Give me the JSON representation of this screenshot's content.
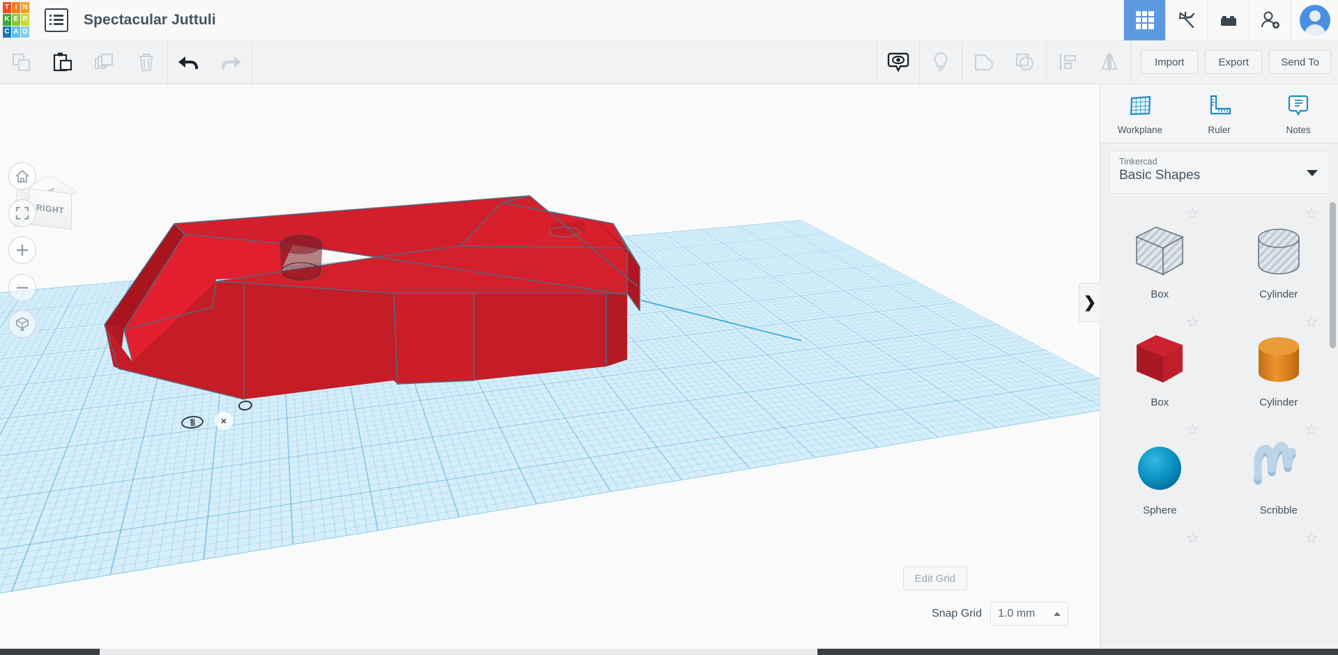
{
  "app": {
    "name": "Tinkercad",
    "logo_letters": [
      "T",
      "I",
      "N",
      "K",
      "E",
      "R",
      "C",
      "A",
      "D"
    ],
    "logo_colors": [
      "#f04c24",
      "#f57c20",
      "#f99d1c",
      "#39a935",
      "#8cc63e",
      "#cbdb2a",
      "#1b75bb",
      "#5bc2e7",
      "#7fcdee"
    ]
  },
  "header": {
    "document_title": "Spectacular Juttuli",
    "menu_icon": "list-menu-icon",
    "right_buttons": [
      {
        "name": "designs-grid",
        "icon": "grid-9-icon",
        "active": true
      },
      {
        "name": "codeblocks",
        "icon": "pickaxe-icon",
        "active": false
      },
      {
        "name": "blocks",
        "icon": "lego-brick-icon",
        "active": false
      },
      {
        "name": "invite-people",
        "icon": "add-person-icon",
        "active": false
      }
    ],
    "avatar": "user-avatar"
  },
  "toolbar": {
    "left_tools": [
      {
        "name": "copy",
        "icon": "copy-icon",
        "enabled": false
      },
      {
        "name": "paste",
        "icon": "paste-icon",
        "enabled": true
      },
      {
        "name": "duplicate",
        "icon": "duplicate-icon",
        "enabled": false
      },
      {
        "name": "delete",
        "icon": "trash-icon",
        "enabled": false
      }
    ],
    "history_tools": [
      {
        "name": "undo",
        "icon": "undo-arrow-icon",
        "enabled": true
      },
      {
        "name": "redo",
        "icon": "redo-arrow-icon",
        "enabled": false
      }
    ],
    "center_tools": [
      {
        "name": "show-hide",
        "icon": "eye-bubble-icon",
        "enabled": true
      },
      {
        "name": "light",
        "icon": "lightbulb-icon",
        "enabled": false
      },
      {
        "name": "group",
        "icon": "group-shapes-icon",
        "enabled": false
      },
      {
        "name": "ungroup",
        "icon": "ungroup-shapes-icon",
        "enabled": false
      },
      {
        "name": "align",
        "icon": "align-icon",
        "enabled": false
      },
      {
        "name": "mirror",
        "icon": "mirror-icon",
        "enabled": false
      }
    ],
    "import_label": "Import",
    "export_label": "Export",
    "send_to_label": "Send To"
  },
  "viewport": {
    "view_cube": {
      "front_face": "RIGHT",
      "top_face": "TOP"
    },
    "nav_buttons": [
      {
        "name": "home-view",
        "icon": "home-icon"
      },
      {
        "name": "fit-to-view",
        "icon": "fit-frame-icon"
      },
      {
        "name": "zoom-in",
        "icon": "plus-icon"
      },
      {
        "name": "zoom-out",
        "icon": "minus-icon"
      },
      {
        "name": "view-toggle",
        "icon": "ortho-cube-icon"
      }
    ],
    "edit_grid_label": "Edit Grid",
    "snap_grid_label": "Snap Grid",
    "snap_grid_value": "1.0 mm",
    "model_color": "#cf1c28",
    "workplane_color": "#d6eef9"
  },
  "right_panel": {
    "tools": [
      {
        "label": "Workplane",
        "icon": "workplane-grid-icon"
      },
      {
        "label": "Ruler",
        "icon": "ruler-icon"
      },
      {
        "label": "Notes",
        "icon": "notes-bubble-icon"
      }
    ],
    "library_source": "Tinkercad",
    "library_name": "Basic Shapes",
    "shapes": [
      {
        "label": "Box",
        "kind": "hole-box",
        "color": "#b6bfca",
        "starred": false
      },
      {
        "label": "Cylinder",
        "kind": "hole-cylinder",
        "color": "#b6bfca",
        "starred": false
      },
      {
        "label": "Box",
        "kind": "solid-box",
        "color": "#c8252e",
        "starred": false
      },
      {
        "label": "Cylinder",
        "kind": "solid-cylinder",
        "color": "#e08420",
        "starred": false
      },
      {
        "label": "Sphere",
        "kind": "solid-sphere",
        "color": "#0e8fc0",
        "starred": false
      },
      {
        "label": "Scribble",
        "kind": "scribble",
        "color": "#a8c4dd",
        "starred": false
      }
    ],
    "collapse_icon": "chevron-right-icon"
  }
}
